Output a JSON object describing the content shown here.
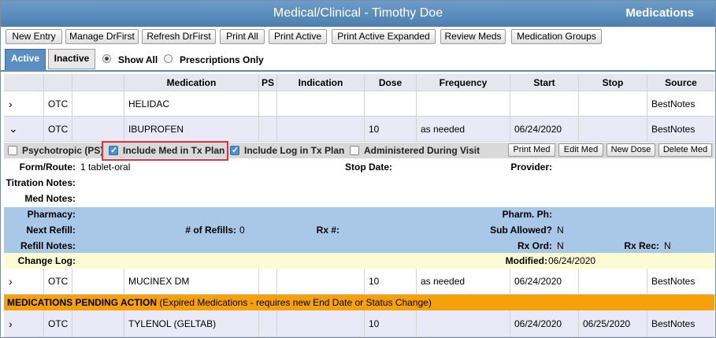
{
  "window": {
    "title": "Medical/Clinical - Timothy Doe",
    "section": "Medications"
  },
  "toolbar": [
    "New Entry",
    "Manage DrFirst",
    "Refresh DrFirst",
    "Print All",
    "Print Active",
    "Print Active Expanded",
    "Review Meds",
    "Medication Groups"
  ],
  "tabs": {
    "active": "Active",
    "inactive": "Inactive"
  },
  "filters": {
    "show_all": "Show All",
    "prescriptions_only": "Prescriptions Only"
  },
  "table": {
    "headers": [
      "Medication",
      "PS",
      "Indication",
      "Dose",
      "Frequency",
      "Start",
      "Stop",
      "Source"
    ],
    "rows": [
      {
        "chevron": "›",
        "type": "OTC",
        "medication": "HELIDAC",
        "ps": "",
        "indication": "",
        "dose": "",
        "frequency": "",
        "start": "",
        "stop": "",
        "source": "BestNotes"
      },
      {
        "chevron": "⌄",
        "type": "OTC",
        "medication": "IBUPROFEN",
        "ps": "",
        "indication": "",
        "dose": "10",
        "frequency": "as needed",
        "start": "06/24/2020",
        "stop": "",
        "source": "BestNotes"
      },
      {
        "chevron": "›",
        "type": "OTC",
        "medication": "MUCINEX DM",
        "ps": "",
        "indication": "",
        "dose": "10",
        "frequency": "as needed",
        "start": "06/24/2020",
        "stop": "",
        "source": "BestNotes"
      },
      {
        "chevron": "›",
        "type": "OTC",
        "medication": "TYLENOL (GELTAB)",
        "ps": "",
        "indication": "",
        "dose": "10",
        "frequency": "",
        "start": "06/24/2020",
        "stop": "06/25/2020",
        "source": "BestNotes"
      }
    ]
  },
  "detail": {
    "psychotropic": "Psychotropic (PS)",
    "include_med": "Include Med in Tx Plan",
    "include_log": "Include Log in Tx Plan",
    "administered": "Administered During Visit",
    "buttons": [
      "Print Med",
      "Edit Med",
      "New Dose",
      "Delete Med"
    ],
    "form_route_label": "Form/Route:",
    "form_route_value": "1 tablet-oral",
    "stop_date_label": "Stop Date:",
    "provider_label": "Provider:",
    "titration_label": "Titration Notes:",
    "med_notes_label": "Med Notes:",
    "pharmacy_label": "Pharmacy:",
    "pharm_ph_label": "Pharm. Ph:",
    "next_refill_label": "Next Refill:",
    "num_refills_label": "# of Refills:",
    "num_refills_value": "0",
    "rx_num_label": "Rx #:",
    "sub_allowed_label": "Sub Allowed?",
    "sub_allowed_value": "N",
    "refill_notes_label": "Refill Notes:",
    "rx_ord_label": "Rx Ord:",
    "rx_ord_value": "N",
    "rx_rec_label": "Rx Rec:",
    "rx_rec_value": "N",
    "change_log_label": "Change Log:",
    "modified_label": "Modified:",
    "modified_value": "06/24/2020"
  },
  "pending": {
    "title": "MEDICATIONS PENDING ACTION",
    "note": " (Expired Medications - requires new End Date or Status Change)"
  },
  "colors": {
    "title_bar": "#5b8fc3",
    "highlight_border": "#e0313d",
    "pending_bar": "#f7a10a",
    "refill_panel": "#a9c8e8",
    "change_log_panel": "#fdfbd4"
  }
}
